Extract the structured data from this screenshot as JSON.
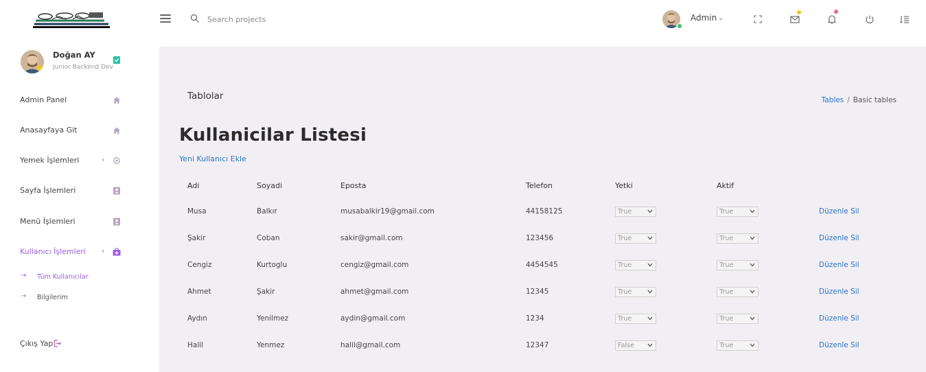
{
  "topbar": {
    "search_placeholder": "Search projects",
    "user_label": "Admin",
    "colors": {
      "mail_badge": "#f5c518",
      "bell_badge": "#f06292"
    },
    "icons": [
      "menu-icon",
      "search-icon",
      "fullscreen-icon",
      "mail-icon",
      "bell-icon",
      "power-icon",
      "settings-list-icon"
    ]
  },
  "sidebar": {
    "profile": {
      "name": "Doğan AY",
      "role": "Junior Backend Dev"
    },
    "items": [
      {
        "label": "Admin Panel",
        "icon": "home-icon"
      },
      {
        "label": "Anasayfaya Git",
        "icon": "home-icon"
      },
      {
        "label": "Yemek İşlemleri",
        "icon": "target-icon"
      },
      {
        "label": "Sayfa İşlemleri",
        "icon": "contact-book-icon"
      },
      {
        "label": "Menü İşlemleri",
        "icon": "contact-book-icon"
      },
      {
        "label": "Kullanıcı İşlemleri",
        "icon": "user-add-icon"
      }
    ],
    "subitems": [
      {
        "label": "Tüm Kullanıcılar"
      },
      {
        "label": "Bilgilerim"
      }
    ],
    "logout_label": "Çıkış Yap",
    "colors": {
      "active": "#9b5de5"
    }
  },
  "main": {
    "section_title": "Tablolar",
    "breadcrumb": {
      "link": "Tables",
      "separator": "/",
      "current": "Basic tables"
    },
    "page_title": "Kullanicilar Listesi",
    "add_user_link": "Yeni Kullanıcı Ekle",
    "table": {
      "headers": [
        "Adi",
        "Soyadi",
        "Eposta",
        "Telefon",
        "Yetki",
        "Aktif"
      ],
      "edit_label": "Düzenle",
      "delete_label": "Sil",
      "rows": [
        {
          "adi": "Musa",
          "soyadi": "Balkır",
          "eposta": "musabalkir19@gmail.com",
          "telefon": "44158125",
          "yetki": "True",
          "aktif": "True"
        },
        {
          "adi": "Şakir",
          "soyadi": "Coban",
          "eposta": "sakir@gmail.com",
          "telefon": "123456",
          "yetki": "True",
          "aktif": "True"
        },
        {
          "adi": "Cengiz",
          "soyadi": "Kurtoglu",
          "eposta": "cengiz@gmail.com",
          "telefon": "4454545",
          "yetki": "True",
          "aktif": "True"
        },
        {
          "adi": "Ahmet",
          "soyadi": "Şakir",
          "eposta": "ahmet@gmail.com",
          "telefon": "12345",
          "yetki": "True",
          "aktif": "True"
        },
        {
          "adi": "Aydın",
          "soyadi": "Yenilmez",
          "eposta": "aydin@gmail.com",
          "telefon": "1234",
          "yetki": "True",
          "aktif": "True"
        },
        {
          "adi": "Halil",
          "soyadi": "Yenmez",
          "eposta": "halil@gmail.com",
          "telefon": "12347",
          "yetki": "False",
          "aktif": "True"
        }
      ]
    },
    "colors": {
      "background": "#f1eff3",
      "link": "#2a74c9"
    }
  }
}
